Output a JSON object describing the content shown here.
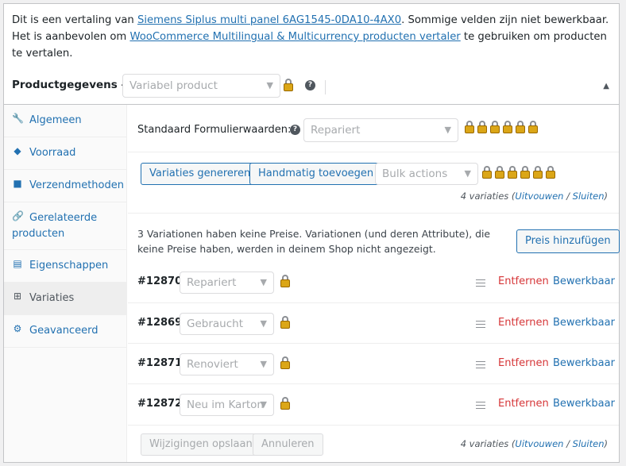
{
  "notice": {
    "part1": "Dit is een vertaling van ",
    "link1": "Siemens Siplus multi panel 6AG1545-0DA10-4AX0",
    "part2": ". Sommige velden zijn niet bewerkbaar. Het is aanbevolen om ",
    "link2": "WooCommerce Multilingual & Multicurrency producten vertaler",
    "part3": " te gebruiken om producten te vertalen."
  },
  "product_data": {
    "label": "Productgegevens —",
    "type_select": "Variabel product"
  },
  "tabs": [
    {
      "label": "Algemeen",
      "icon": "wrench-icon"
    },
    {
      "label": "Voorraad",
      "icon": "tag-icon"
    },
    {
      "label": "Verzendmethoden",
      "icon": "truck-icon"
    },
    {
      "label": "Gerelateerde producten",
      "icon": "link-icon"
    },
    {
      "label": "Eigenschappen",
      "icon": "table-icon"
    },
    {
      "label": "Variaties",
      "icon": "grid-icon"
    },
    {
      "label": "Geavanceerd",
      "icon": "gear-icon"
    }
  ],
  "defaults": {
    "label": "Standaard Formulierwaarden:",
    "select": "Repariert"
  },
  "toolbar": {
    "generate": "Variaties genereren",
    "manual_add": "Handmatig toevoegen",
    "bulk": "Bulk actions"
  },
  "count": {
    "text": "4 variaties (",
    "expand": "Uitvouwen",
    "sep": " / ",
    "close": "Sluiten",
    "end": ")"
  },
  "warning": {
    "text": "3 Variationen haben keine Preise. Variationen (und deren Attribute), die keine Preise haben, werden in deinem Shop nicht angezeigt.",
    "button": "Preis hinzufügen"
  },
  "variations": [
    {
      "id": "#12870",
      "value": "Repariert",
      "remove": "Entfernen",
      "edit": "Bewerkbaar"
    },
    {
      "id": "#12869",
      "value": "Gebraucht",
      "remove": "Entfernen",
      "edit": "Bewerkbaar"
    },
    {
      "id": "#12871",
      "value": "Renoviert",
      "remove": "Entfernen",
      "edit": "Bewerkbaar"
    },
    {
      "id": "#12872",
      "value": "Neu im Karton",
      "remove": "Entfernen",
      "edit": "Bewerkbaar"
    }
  ],
  "footer": {
    "save": "Wijzigingen opslaan",
    "cancel": "Annuleren"
  },
  "colors": {
    "accent": "#2271b1",
    "danger": "#d63638",
    "lock": "#dba617"
  }
}
